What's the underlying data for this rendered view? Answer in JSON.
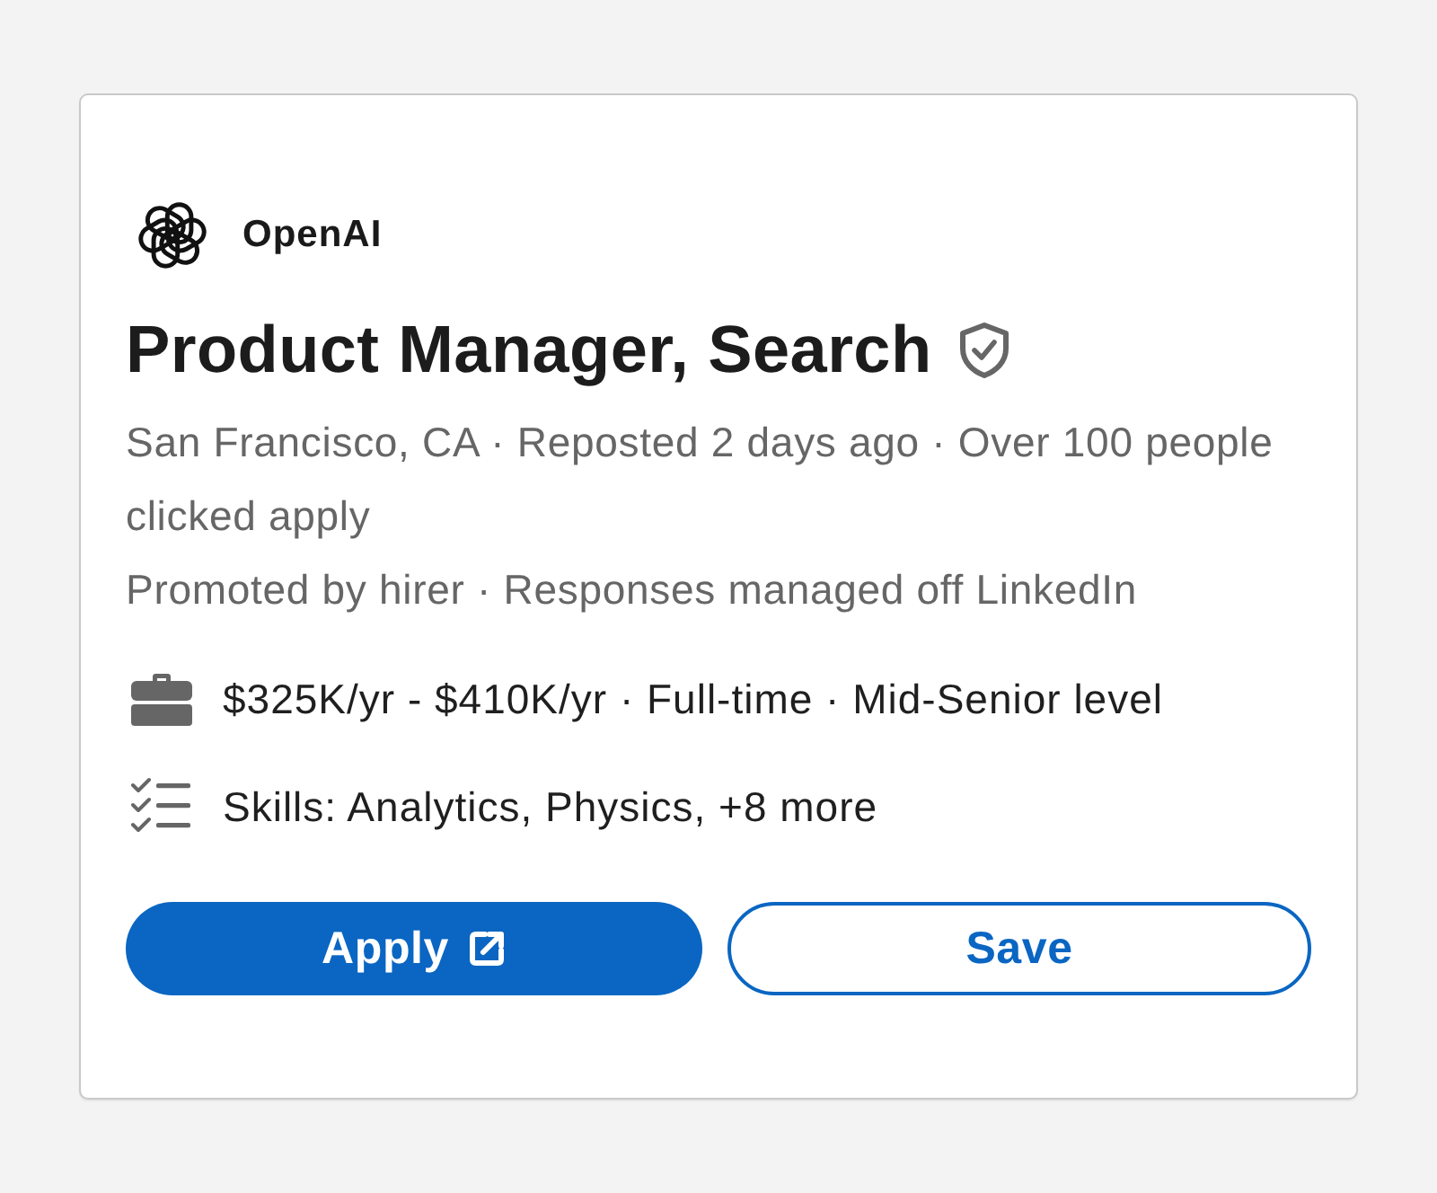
{
  "company": {
    "name": "OpenAI"
  },
  "job": {
    "title": "Product Manager, Search",
    "verified": true
  },
  "details": [
    "San Francisco, CA · Reposted 2 days ago · Over 100 people clicked apply",
    "Promoted by hirer · Responses managed off LinkedIn"
  ],
  "highlights": [
    {
      "kind": "briefcase",
      "text": "$325K/yr - $410K/yr · Full-time · Mid-Senior level"
    },
    {
      "kind": "skills",
      "text": "Skills: Analytics, Physics, +8 more"
    }
  ],
  "actions": [
    {
      "kind": "primary",
      "label": "Apply",
      "external": true
    },
    {
      "kind": "secondary",
      "label": "Save",
      "external": false
    }
  ]
}
